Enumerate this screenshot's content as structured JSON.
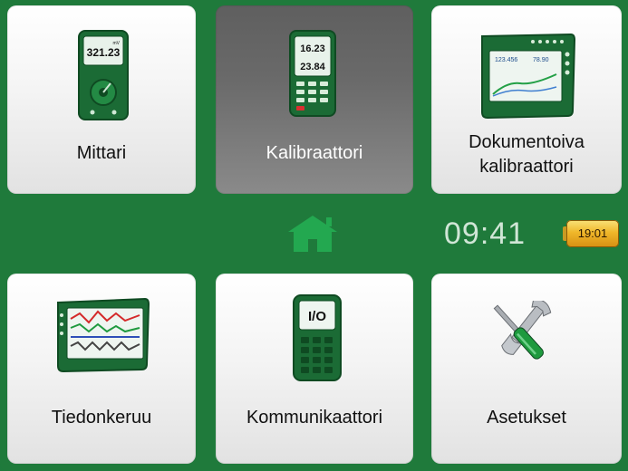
{
  "tiles": [
    {
      "label": "Mittari"
    },
    {
      "label": "Kalibraattori"
    },
    {
      "label": "Dokumentoiva",
      "label2": "kalibraattori"
    },
    {
      "label": "Tiedonkeruu"
    },
    {
      "label": "Kommunikaattori"
    },
    {
      "label": "Asetukset"
    }
  ],
  "status": {
    "clock": "09:41",
    "battery_time": "19:01",
    "home_icon": "home-icon"
  },
  "devices": {
    "meter_display": "321.23",
    "meter_unit": "mV",
    "calibrator_display_top": "16.23",
    "calibrator_display_bottom": "23.84",
    "doc_cal_display_left": "123.456",
    "doc_cal_display_right": "78.90",
    "communicator_display": "I/O"
  },
  "colors": {
    "brand_green": "#1f7a3b",
    "active_tile": "#6a6a6a",
    "battery": "#f0b72a"
  }
}
